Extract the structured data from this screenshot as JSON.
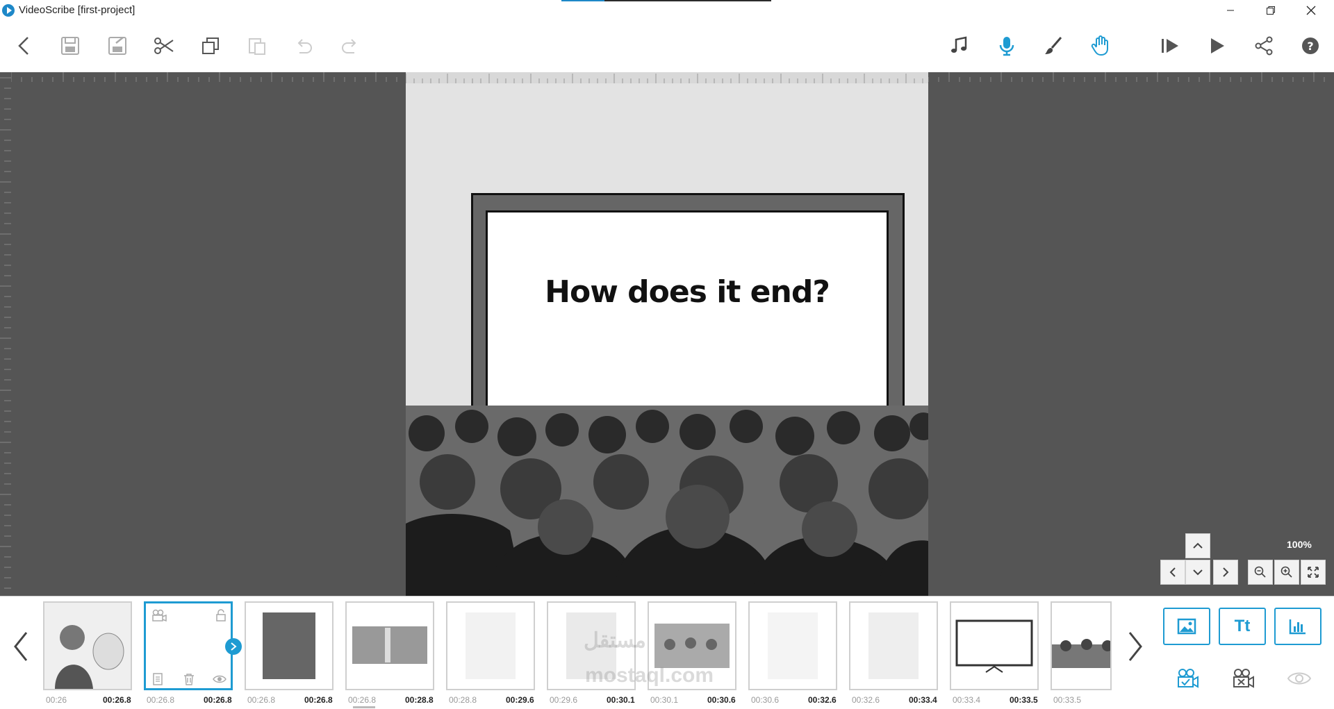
{
  "window": {
    "title": "VideoScribe [first-project]",
    "accent_color": "#1e9bd2",
    "workspace_color": "#555555"
  },
  "toolbar": {
    "left_icons": [
      "back-icon",
      "save-icon",
      "save-as-icon",
      "cut-icon",
      "copy-icon",
      "paste-icon",
      "undo-icon",
      "redo-icon"
    ],
    "right_icons": [
      "music-icon",
      "microphone-icon",
      "brush-icon",
      "hand-icon",
      "play-from-icon",
      "play-icon",
      "share-icon",
      "help-icon"
    ]
  },
  "canvas": {
    "screen_text": "How does it end?"
  },
  "zoom": {
    "level": "100%"
  },
  "timeline": {
    "items": [
      {
        "start": "00:26",
        "end": "00:26.8"
      },
      {
        "start": "00:26.8",
        "end": "00:26.8"
      },
      {
        "start": "00:26.8",
        "end": "00:26.8"
      },
      {
        "start": "00:26.8",
        "end": "00:28.8"
      },
      {
        "start": "00:28.8",
        "end": "00:29.6"
      },
      {
        "start": "00:29.6",
        "end": "00:30.1"
      },
      {
        "start": "00:30.1",
        "end": "00:30.6"
      },
      {
        "start": "00:30.6",
        "end": "00:32.6"
      },
      {
        "start": "00:32.6",
        "end": "00:33.4"
      },
      {
        "start": "00:33.4",
        "end": "00:33.5"
      },
      {
        "start": "00:33.5",
        "end": ""
      }
    ],
    "add_buttons": {
      "text_label": "Tt"
    }
  }
}
